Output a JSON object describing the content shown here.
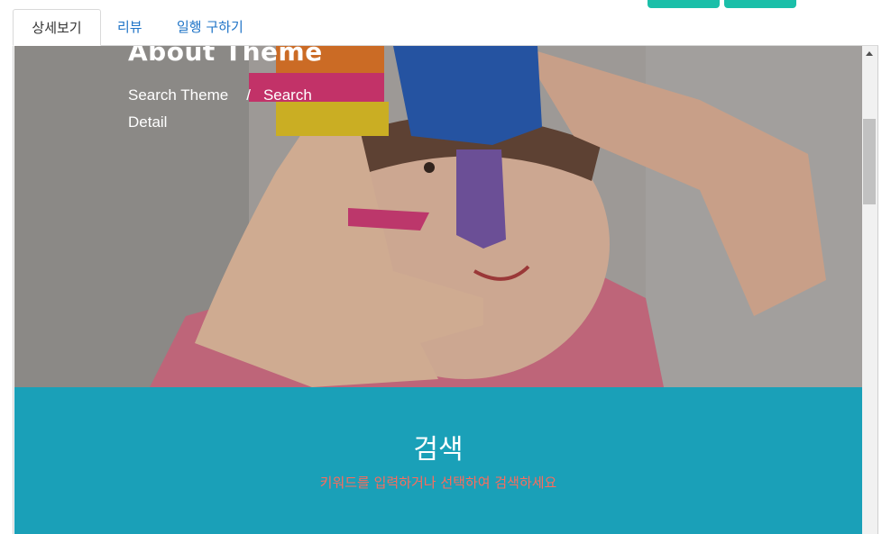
{
  "tabs": [
    {
      "label": "상세보기",
      "active": true
    },
    {
      "label": "리뷰",
      "active": false
    },
    {
      "label": "일행 구하기",
      "active": false
    }
  ],
  "hero": {
    "title": "About Theme",
    "breadcrumb": {
      "home": "Search Theme",
      "separator": "/",
      "current": "Search Detail"
    }
  },
  "search": {
    "title": "검색",
    "subtitle": "키워드를 입력하거나 선택하여 검색하세요"
  },
  "colors": {
    "accent_button": "#1bbfa9",
    "search_band": "#1aa0b8",
    "subtitle": "#ff6b5b",
    "tab_link": "#1f74c7"
  }
}
